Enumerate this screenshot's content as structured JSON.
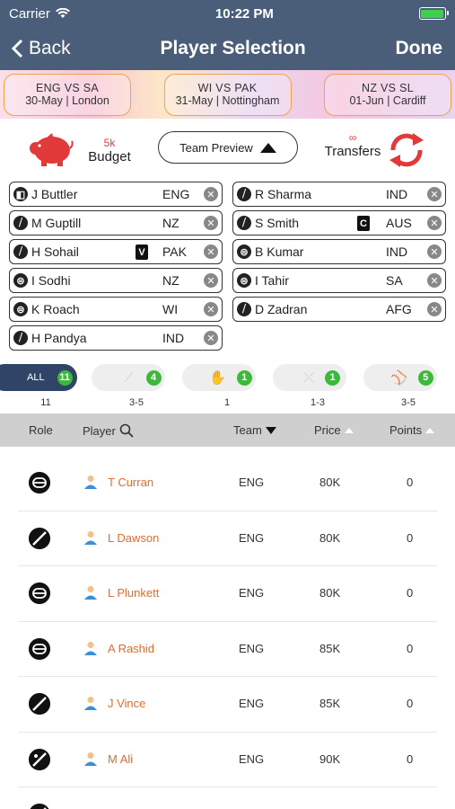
{
  "status": {
    "carrier": "Carrier",
    "time": "10:22 PM",
    "battery_level": 1.0
  },
  "nav": {
    "back_label": "Back",
    "title": "Player Selection",
    "done_label": "Done"
  },
  "matches": [
    {
      "teams": "ENG VS SA",
      "date": "30-May",
      "venue": "London"
    },
    {
      "teams": "WI VS PAK",
      "date": "31-May",
      "venue": "Nottingham"
    },
    {
      "teams": "NZ VS SL",
      "date": "01-Jun",
      "venue": "Cardiff"
    }
  ],
  "budget": {
    "value": "5k",
    "label": "Budget"
  },
  "team_preview_label": "Team Preview",
  "transfers": {
    "value": "∞",
    "label": "Transfers"
  },
  "selected_left": [
    {
      "name": "J Buttler",
      "team": "ENG",
      "role_glyph": "◧"
    },
    {
      "name": "M Guptill",
      "team": "NZ",
      "role_glyph": "⧸"
    },
    {
      "name": "H Sohail",
      "team": "PAK",
      "role_glyph": "⧸",
      "badge": "V"
    },
    {
      "name": "I Sodhi",
      "team": "NZ",
      "role_glyph": "⊜"
    },
    {
      "name": "K Roach",
      "team": "WI",
      "role_glyph": "⊜"
    },
    {
      "name": "H Pandya",
      "team": "IND",
      "role_glyph": "⧸"
    }
  ],
  "selected_right": [
    {
      "name": "R Sharma",
      "team": "IND",
      "role_glyph": "⧸"
    },
    {
      "name": "S Smith",
      "team": "AUS",
      "role_glyph": "⧸",
      "badge": "C"
    },
    {
      "name": "B Kumar",
      "team": "IND",
      "role_glyph": "⊜"
    },
    {
      "name": "I Tahir",
      "team": "SA",
      "role_glyph": "⊜"
    },
    {
      "name": "D Zadran",
      "team": "AFG",
      "role_glyph": "⧸"
    }
  ],
  "filters": {
    "all_label": "ALL",
    "pills": [
      {
        "label": "ALL",
        "count": "11",
        "range": "11",
        "icon": "all-icon"
      },
      {
        "count": "4",
        "range": "3-5",
        "icon": "bat-icon"
      },
      {
        "count": "1",
        "range": "1",
        "icon": "wicketkeeper-gloves-icon"
      },
      {
        "count": "1",
        "range": "1-3",
        "icon": "allrounder-icon"
      },
      {
        "count": "5",
        "range": "3-5",
        "icon": "ball-icon"
      }
    ]
  },
  "table": {
    "headers": {
      "role": "Role",
      "player": "Player",
      "team": "Team",
      "price": "Price",
      "points": "Points"
    },
    "rows": [
      {
        "name": "T Curran",
        "team": "ENG",
        "price": "80K",
        "points": "0",
        "role": "bowler"
      },
      {
        "name": "L Dawson",
        "team": "ENG",
        "price": "80K",
        "points": "0",
        "role": "batsman"
      },
      {
        "name": "L Plunkett",
        "team": "ENG",
        "price": "80K",
        "points": "0",
        "role": "bowler"
      },
      {
        "name": "A Rashid",
        "team": "ENG",
        "price": "85K",
        "points": "0",
        "role": "bowler"
      },
      {
        "name": "J Vince",
        "team": "ENG",
        "price": "85K",
        "points": "0",
        "role": "batsman"
      },
      {
        "name": "M Ali",
        "team": "ENG",
        "price": "90K",
        "points": "0",
        "role": "allrounder"
      }
    ]
  },
  "colors": {
    "nav_bg": "#4a5e7a",
    "accent_red": "#e23a3a",
    "player_name": "#e86a2d",
    "count_green": "#3cb93c",
    "active_pill": "#2f4466"
  }
}
